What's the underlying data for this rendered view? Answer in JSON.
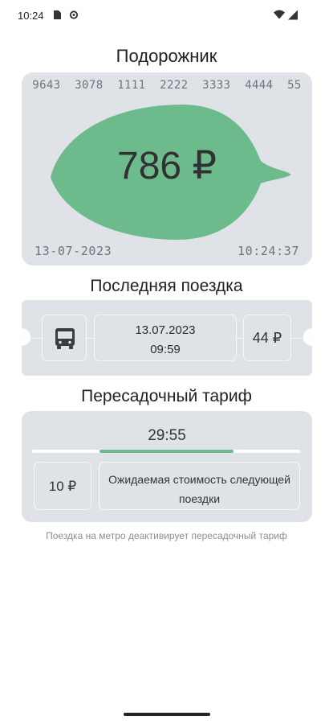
{
  "status_bar": {
    "time": "10:24",
    "icons": [
      "sim-card-icon",
      "settings-gear-icon",
      "wifi-icon",
      "cell-signal-icon"
    ]
  },
  "card": {
    "title": "Подорожник",
    "number": "9643  3078  1111  2222  3333  4444  55",
    "balance": "786 ₽",
    "date": "13-07-2023",
    "time": "10:24:37",
    "leaf_color": "#6dbb8c"
  },
  "last_trip": {
    "title": "Последняя поездка",
    "transport_icon": "bus-icon",
    "date": "13.07.2023",
    "time": "09:59",
    "price": "44 ₽"
  },
  "transfer": {
    "title": "Пересадочный тариф",
    "timer": "29:55",
    "progress": 0.5,
    "fare": "10 ₽",
    "expected_label": "Ожидаемая стоимость следующей поездки",
    "accent_color": "#6dbb8c"
  },
  "note": "Поездка на метро деактивирует пересадочный тариф"
}
